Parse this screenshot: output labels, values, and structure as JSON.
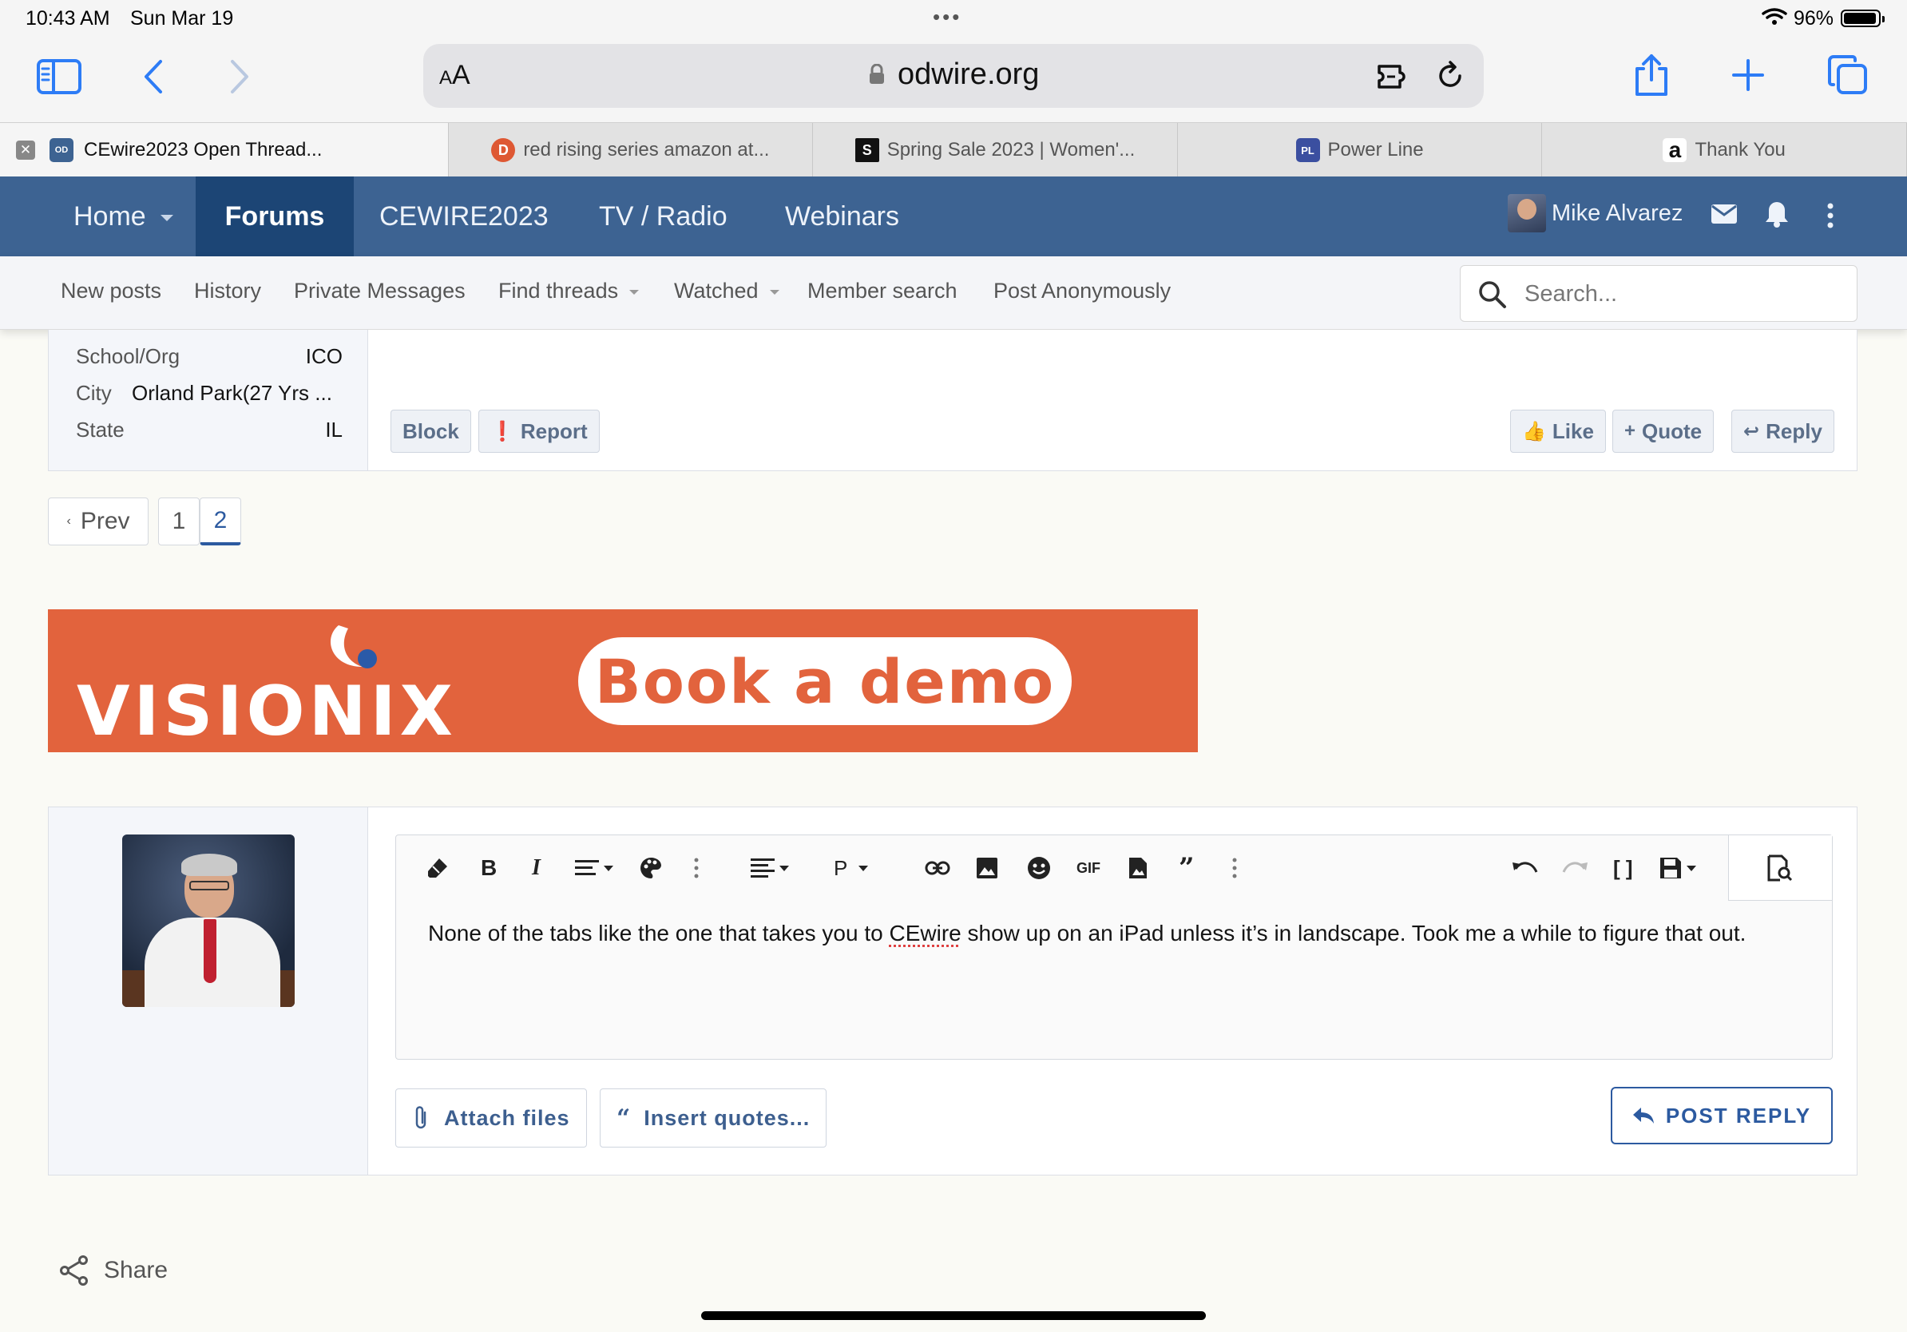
{
  "status": {
    "time": "10:43 AM",
    "date": "Sun Mar 19",
    "battery": "96%"
  },
  "browser": {
    "aa_label": "A",
    "aa_small": "A",
    "url": "odwire.org",
    "tabs": [
      {
        "title": "CEwire2023 Open Thread...",
        "active": true,
        "fav_text": "OD",
        "fav_color": "#3d6392"
      },
      {
        "title": "red rising series amazon at...",
        "fav_text": "D",
        "fav_color": "#de5833"
      },
      {
        "title": "Spring Sale 2023 | Women'...",
        "fav_text": "S",
        "fav_color": "#111111"
      },
      {
        "title": "Power Line",
        "fav_text": "PL",
        "fav_color": "#3b4fa0"
      },
      {
        "title": "Thank You",
        "fav_text": "a",
        "fav_color": "#ffffff"
      }
    ]
  },
  "nav": {
    "items": [
      "Home",
      "Forums",
      "CEWIRE2023",
      "TV / Radio",
      "Webinars"
    ],
    "user": "Mike Alvarez"
  },
  "subnav": {
    "items": [
      "New posts",
      "History",
      "Private Messages",
      "Find threads",
      "Watched",
      "Member search",
      "Post Anonymously"
    ],
    "search_placeholder": "Search..."
  },
  "profile": {
    "school_label": "School/Org",
    "school_value": "ICO",
    "city_label": "City",
    "city_value": "Orland Park(27 Yrs ...",
    "state_label": "State",
    "state_value": "IL"
  },
  "post_actions": {
    "block": "Block",
    "report": "Report",
    "like": "Like",
    "quote": "Quote",
    "reply": "Reply"
  },
  "pagination": {
    "prev": "Prev",
    "pages": [
      "1",
      "2"
    ],
    "current": "2"
  },
  "banner": {
    "brand": "VISIONIX",
    "cta": "Book a demo"
  },
  "editor": {
    "text_before": "None of the tabs like the one that takes you to ",
    "text_flagged": "CEwire",
    "text_after": " show up on an iPad unless it’s in landscape.  Took me a while to figure that out.",
    "paragraph_label": "P",
    "gif_label": "GIF"
  },
  "reply_actions": {
    "attach": "Attach files",
    "insert_quotes": "Insert quotes...",
    "post_reply": "POST REPLY"
  },
  "share_label": "Share",
  "colors": {
    "nav": "#3d6392",
    "nav_active": "#1c4575",
    "accent": "#2c5aa0",
    "banner": "#e2633d"
  }
}
